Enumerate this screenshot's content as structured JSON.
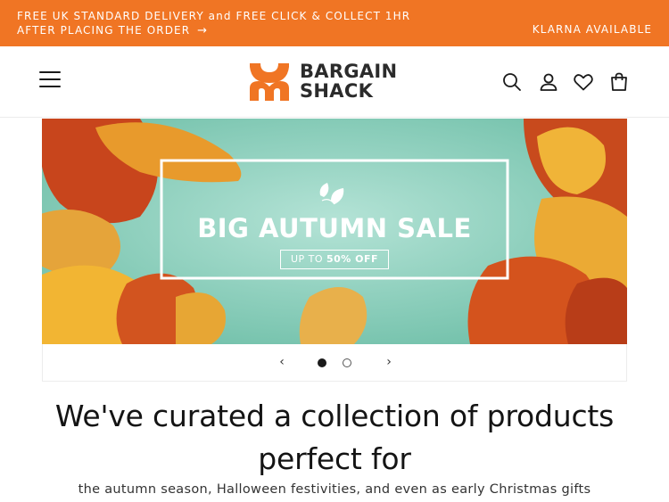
{
  "announcement": {
    "line1": "FREE UK STANDARD DELIVERY and FREE CLICK & COLLECT 1HR",
    "line2": "AFTER PLACING THE ORDER",
    "arrow": "→",
    "right_text": "KLARNA AVAILABLE"
  },
  "header": {
    "logo_line1": "BARGAIN",
    "logo_line2": "SHACK",
    "icons": [
      "menu-icon",
      "search-icon",
      "account-icon",
      "wishlist-heart-icon",
      "cart-bag-icon"
    ]
  },
  "hero": {
    "title": "BIG AUTUMN SALE",
    "badge_prefix": "UP TO",
    "badge_value": "50% OFF",
    "slide_count": 2,
    "active_slide": 1
  },
  "slider": {
    "prev_glyph": "‹",
    "next_glyph": "›"
  },
  "content": {
    "headline_line1": "We've curated a collection of products",
    "headline_line2": "perfect for",
    "subline": "the autumn season, Halloween festivities, and even as early Christmas gifts"
  },
  "colors": {
    "accent": "#f07524",
    "hero_bg": "#8fcfbd",
    "text_dark": "#1a1a1a"
  }
}
